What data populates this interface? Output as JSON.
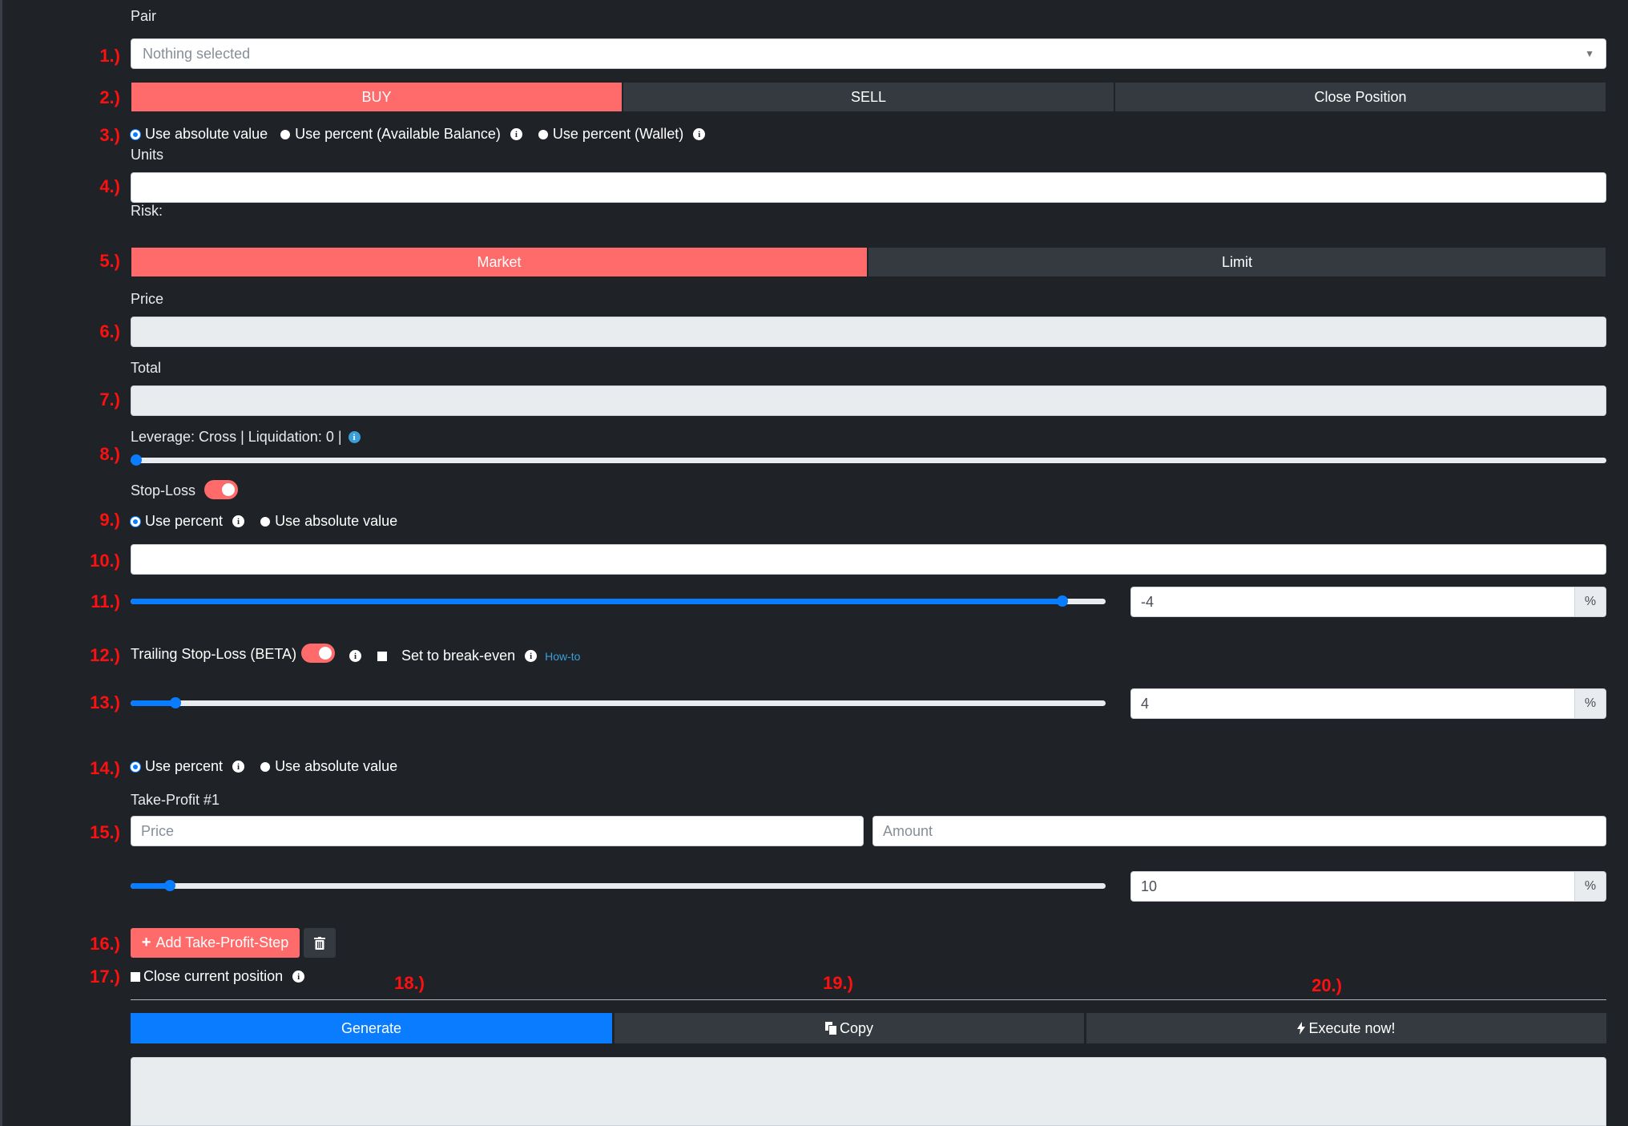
{
  "step_numbers": [
    "1.)",
    "2.)",
    "3.)",
    "4.)",
    "5.)",
    "6.)",
    "7.)",
    "8.)",
    "9.)",
    "10.)",
    "11.)",
    "12.)",
    "13.)",
    "14.)",
    "15.)",
    "16.)",
    "17.)",
    "18.)",
    "19.)",
    "20.)"
  ],
  "pair": {
    "label": "Pair",
    "placeholder": "Nothing selected"
  },
  "side_buttons": [
    "BUY",
    "SELL",
    "Close Position"
  ],
  "amount_mode": {
    "options": [
      "Use absolute value",
      "Use percent (Available Balance)",
      "Use percent (Wallet)"
    ],
    "selected": 0
  },
  "units": {
    "label": "Units",
    "value": ""
  },
  "risk": {
    "label": "Risk:"
  },
  "order_type": [
    "Market",
    "Limit"
  ],
  "price": {
    "label": "Price",
    "value": ""
  },
  "total": {
    "label": "Total",
    "value": ""
  },
  "leverage": {
    "label": "Leverage: Cross | Liquidation: 0 |",
    "slider_fraction": 0.0
  },
  "stop_loss": {
    "label": "Stop-Loss",
    "enabled": true,
    "mode_options": [
      "Use percent",
      "Use absolute value"
    ],
    "value": "",
    "percent": "-4",
    "slider_fraction": 0.956,
    "unit": "%"
  },
  "trailing": {
    "label": "Trailing Stop-Loss (BETA)",
    "enabled": true,
    "break_even_label": "Set to break-even",
    "howto_label": "How-to",
    "percent": "4",
    "slider_fraction": 0.046,
    "unit": "%"
  },
  "take_profit": {
    "mode_options": [
      "Use percent",
      "Use absolute value"
    ],
    "step_label": "Take-Profit #1",
    "price_placeholder": "Price",
    "amount_placeholder": "Amount",
    "percent": "10",
    "slider_fraction": 0.04,
    "unit": "%",
    "add_button": "Add Take-Profit-Step"
  },
  "close_position_label": "Close current position",
  "actions": {
    "generate": "Generate",
    "copy": "Copy",
    "execute": "Execute now!"
  },
  "colors": {
    "accent_red": "#ff6b6b",
    "primary_blue": "#0a7cff",
    "background": "#1f2227",
    "dark_button": "#343a40"
  }
}
